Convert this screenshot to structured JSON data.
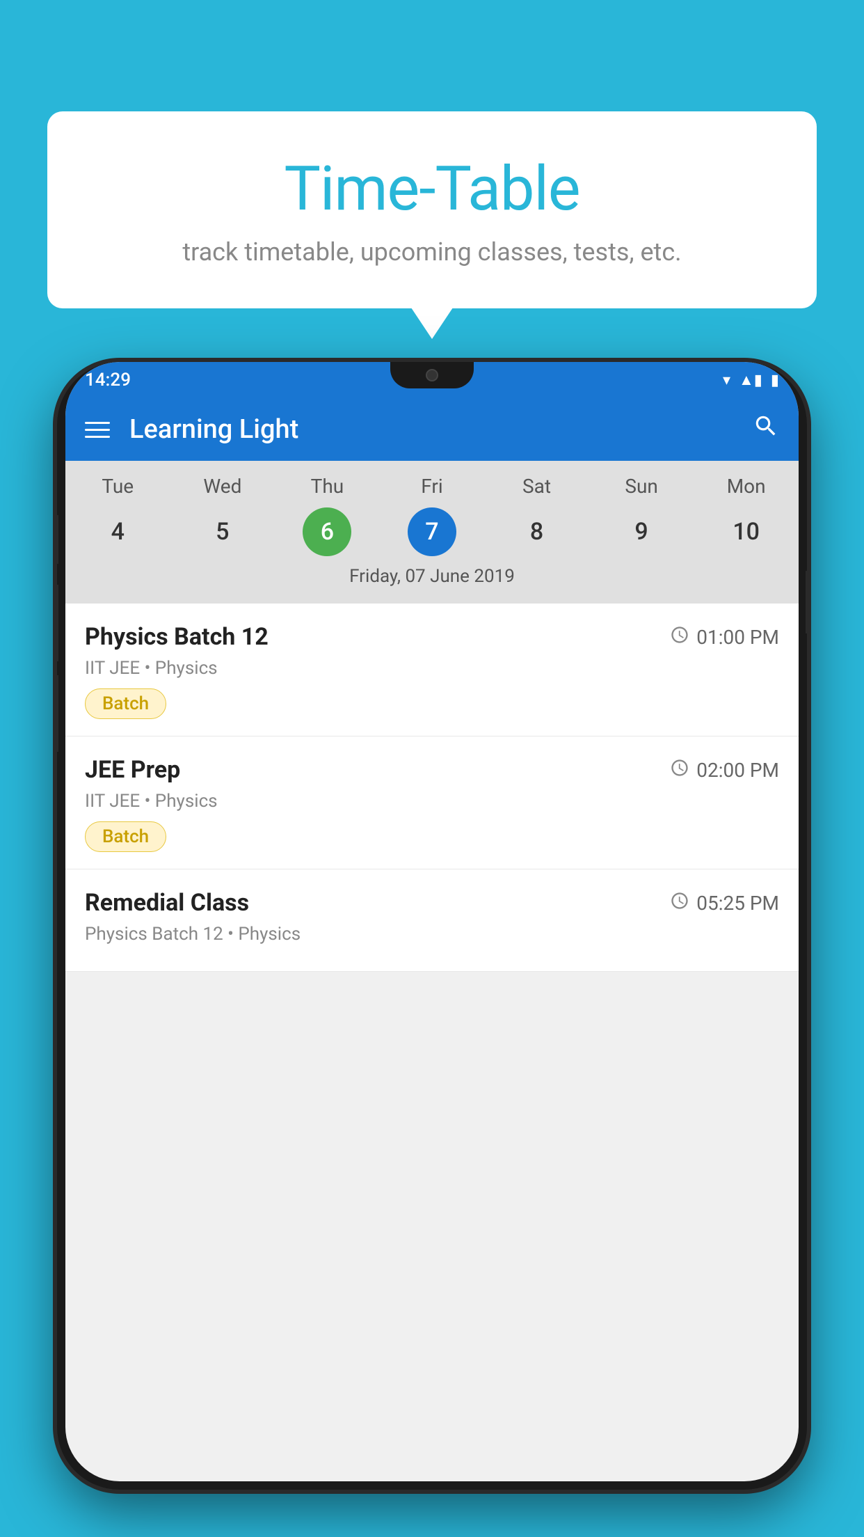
{
  "background_color": "#29b6d8",
  "speech_bubble": {
    "title": "Time-Table",
    "subtitle": "track timetable, upcoming classes, tests, etc."
  },
  "phone": {
    "status_bar": {
      "time": "14:29",
      "signal_icon": "▼▲",
      "battery_icon": "▮"
    },
    "app_bar": {
      "title": "Learning Light",
      "menu_icon": "menu",
      "search_icon": "search"
    },
    "calendar": {
      "days": [
        "Tue",
        "Wed",
        "Thu",
        "Fri",
        "Sat",
        "Sun",
        "Mon"
      ],
      "dates": [
        "4",
        "5",
        "6",
        "7",
        "8",
        "9",
        "10"
      ],
      "today_index": 2,
      "selected_index": 3,
      "selected_label": "Friday, 07 June 2019"
    },
    "schedule_items": [
      {
        "title": "Physics Batch 12",
        "time": "01:00 PM",
        "subtitle": "IIT JEE • Physics",
        "badge": "Batch"
      },
      {
        "title": "JEE Prep",
        "time": "02:00 PM",
        "subtitle": "IIT JEE • Physics",
        "badge": "Batch"
      },
      {
        "title": "Remedial Class",
        "time": "05:25 PM",
        "subtitle": "Physics Batch 12 • Physics",
        "badge": null
      }
    ]
  }
}
